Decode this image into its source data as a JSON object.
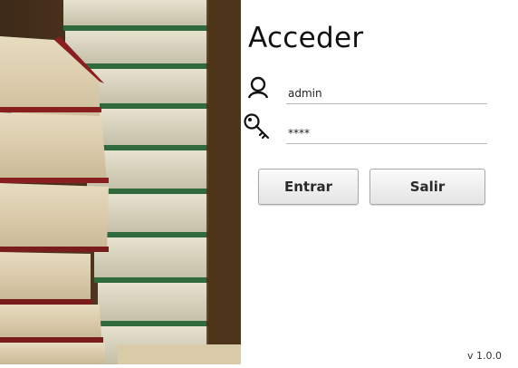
{
  "login": {
    "title": "Acceder",
    "username_value": "admin",
    "password_value": "****",
    "enter_label": "Entrar",
    "exit_label": "Salir",
    "version": "v 1.0.0"
  },
  "icons": {
    "user": "user-icon",
    "password": "key-icon"
  },
  "colors": {
    "background": "#ffffff",
    "underline": "#b9b9b9",
    "text": "#111111"
  }
}
